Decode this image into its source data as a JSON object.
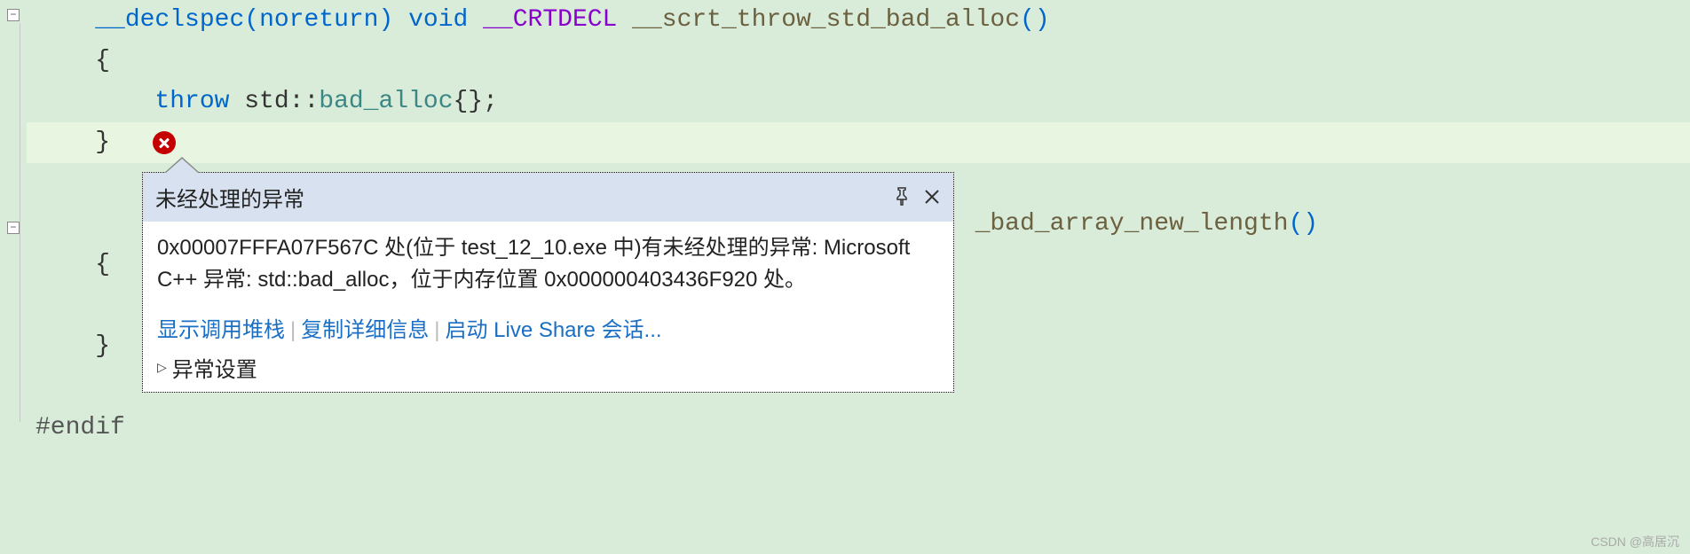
{
  "code": {
    "line1_declspec": "__declspec",
    "line1_paren_open": "(",
    "line1_noreturn": "noreturn",
    "line1_paren_close": ")",
    "line1_void": " void ",
    "line1_crtdecl": "__CRTDECL",
    "line1_fn": " __scrt_throw_std_bad_alloc",
    "line1_parens": "()",
    "line2": "{",
    "line3_throw": "throw",
    "line3_std": " std",
    "line3_colcol": "::",
    "line3_badalloc": "bad_alloc",
    "line3_braces": "{}",
    "line3_semi": ";",
    "line4": "}",
    "line5_fn": "_bad_array_new_length",
    "line5_parens": "()",
    "line6": "{",
    "line8": "}",
    "endif": "#endif"
  },
  "tooltip": {
    "title": "未经处理的异常",
    "body": "0x00007FFFA07F567C 处(位于 test_12_10.exe 中)有未经处理的异常: Microsoft C++ 异常: std::bad_alloc，位于内存位置 0x000000403436F920 处。",
    "actions": {
      "stacktrace": "显示调用堆栈",
      "copy": "复制详细信息",
      "liveshare": "启动 Live Share 会话..."
    },
    "footer": "异常设置"
  },
  "watermark": "CSDN @高居沉"
}
